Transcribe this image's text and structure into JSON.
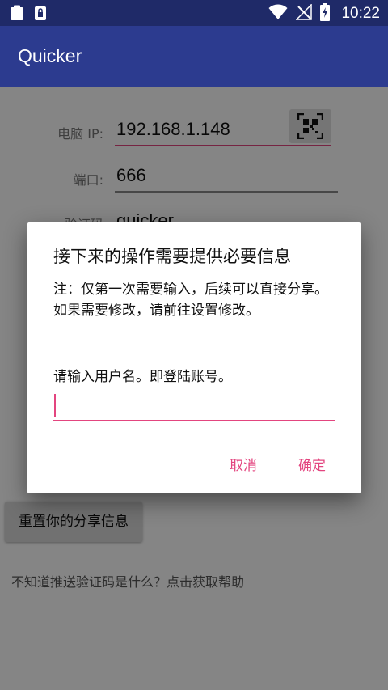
{
  "status_bar": {
    "time": "10:22",
    "icons": [
      "clipboard-icon",
      "lock-badge-icon",
      "wifi-icon",
      "no-signal-icon",
      "battery-charging-icon"
    ]
  },
  "app_bar": {
    "title": "Quicker"
  },
  "form": {
    "ip_label": "电脑 IP:",
    "ip_value": "192.168.1.148",
    "port_label": "端口:",
    "port_value": "666",
    "code_label": "验证码",
    "code_value": "quicker"
  },
  "reset_button": "重置你的分享信息",
  "help_link": "不知道推送验证码是什么？点击获取帮助",
  "dialog": {
    "title": "接下来的操作需要提供必要信息",
    "message": "注：仅第一次需要输入，后续可以直接分享。如果需要修改，请前往设置修改。",
    "prompt": "请输入用户名。即登陆账号。",
    "input_value": "",
    "cancel_label": "取消",
    "ok_label": "确定"
  },
  "colors": {
    "status_bar": "#1f2a68",
    "app_bar": "#2c3b8f",
    "accent": "#e3457f"
  }
}
